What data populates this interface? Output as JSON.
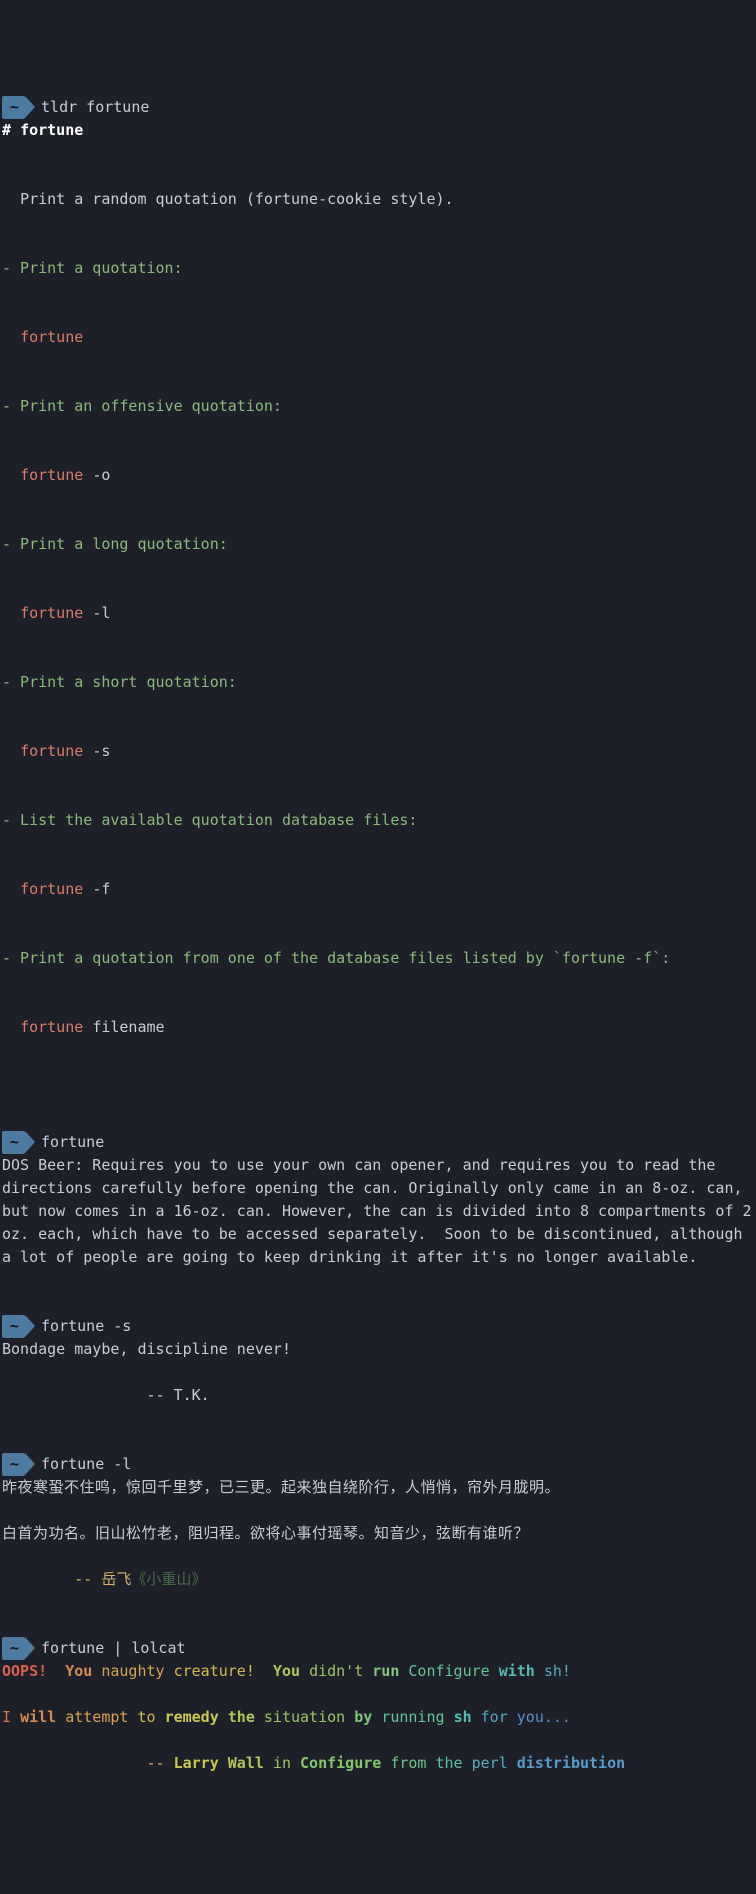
{
  "prompts": {
    "tilde": "~",
    "cmd1": "tldr fortune",
    "cmd2": "fortune",
    "cmd3": "fortune -s",
    "cmd4": "fortune -l",
    "cmd5": "fortune | lolcat"
  },
  "tldr": {
    "heading_hash": "# ",
    "heading_name": "fortune",
    "description": "  Print a random quotation (fortune-cookie style).",
    "items": [
      {
        "desc": "- Print a quotation:",
        "cmd": "fortune",
        "arg": ""
      },
      {
        "desc": "- Print an offensive quotation:",
        "cmd": "fortune ",
        "arg": "-o"
      },
      {
        "desc": "- Print a long quotation:",
        "cmd": "fortune ",
        "arg": "-l"
      },
      {
        "desc": "- Print a short quotation:",
        "cmd": "fortune ",
        "arg": "-s"
      },
      {
        "desc": "- List the available quotation database files:",
        "cmd": "fortune ",
        "arg": "-f"
      },
      {
        "desc": "- Print a quotation from one of the database files listed by `fortune -f`:",
        "cmd": "fortune ",
        "arg": "filename"
      }
    ]
  },
  "outputs": {
    "dosbeer": "DOS Beer: Requires you to use your own can opener, and requires you to read the directions carefully before opening the can. Originally only came in an 8-oz. can, but now comes in a 16-oz. can. However, the can is divided into 8 compartments of 2 oz. each, which have to be accessed separately.  Soon to be discontinued, although a lot of people are going to keep drinking it after it's no longer available.",
    "short_line1": "Bondage maybe, discipline never!",
    "short_line2": "                -- T.K.",
    "long_line1": "昨夜寒蛩不住鸣，惊回千里梦，已三更。起来独自绕阶行，人悄悄，帘外月胧明。",
    "long_line2": "白首为功名。旧山松竹老，阻归程。欲将心事付瑶琴。知音少，弦断有谁听？",
    "long_attr_prefix": "        ",
    "long_attr_dash": "-- ",
    "long_attr_author": "岳飞",
    "long_attr_book": "《小重山》"
  },
  "lolcat": {
    "line1": [
      "OOPS!",
      "  ",
      "You ",
      "naughty ",
      "creature!",
      "  ",
      "You ",
      "didn't ",
      "run ",
      "Configure ",
      "with ",
      "sh!"
    ],
    "line2": [
      "I ",
      "will ",
      "attempt ",
      "to ",
      "remedy ",
      "the ",
      "situation ",
      "by ",
      "running ",
      "sh ",
      "for ",
      "you..."
    ],
    "line3_pad": "                ",
    "line3": [
      "-- ",
      "Larry ",
      "Wall ",
      "in ",
      "Configure ",
      "from ",
      "the ",
      "perl ",
      "distribution"
    ]
  }
}
